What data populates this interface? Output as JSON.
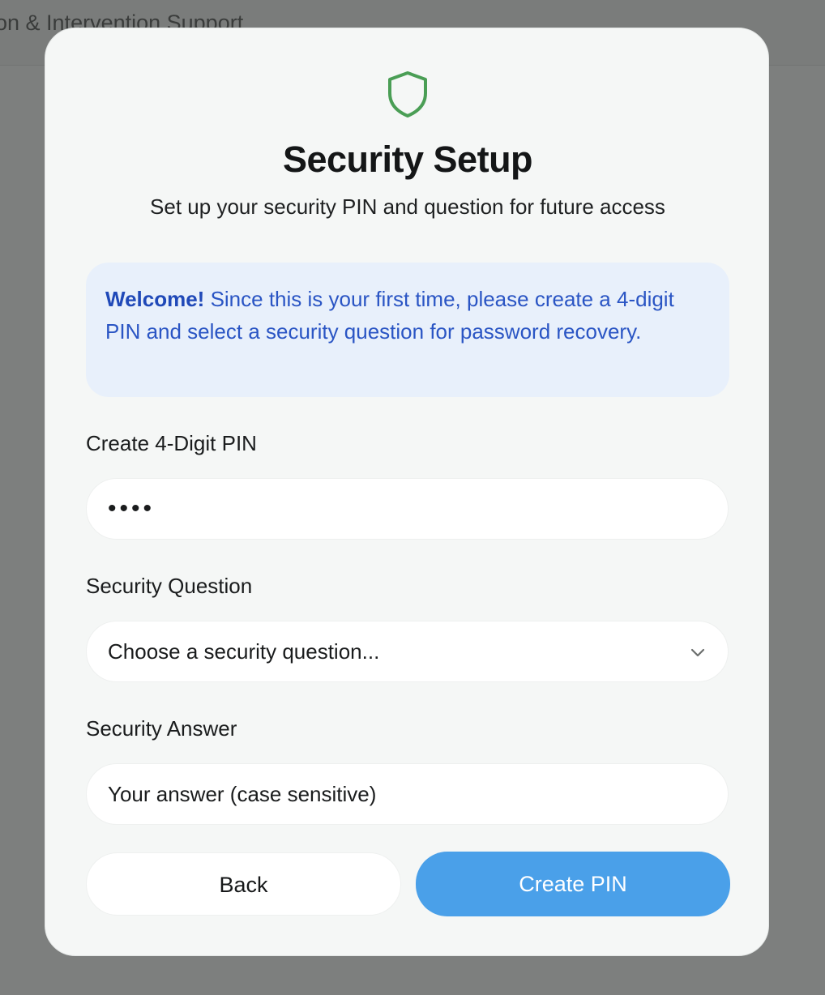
{
  "background": {
    "header_title": "on & Intervention Support"
  },
  "modal": {
    "icon": "shield-icon",
    "title": "Security Setup",
    "subtitle": "Set up your security PIN and question for future access",
    "info": {
      "strong": "Welcome!",
      "text": " Since this is your first time, please create a 4-digit PIN and select a security question for password recovery."
    },
    "pin": {
      "label": "Create 4-Digit PIN",
      "value": "••••"
    },
    "question": {
      "label": "Security Question",
      "selected": "Choose a security question..."
    },
    "answer": {
      "label": "Security Answer",
      "placeholder": "Your answer (case sensitive)"
    },
    "buttons": {
      "back": "Back",
      "create": "Create PIN"
    }
  },
  "colors": {
    "overlay": "#7d7f7e",
    "modal_bg": "#f5f7f6",
    "shield": "#4a9e55",
    "info_bg": "#e8f0fb",
    "info_text": "#2a55c4",
    "primary": "#4aa0e9"
  }
}
